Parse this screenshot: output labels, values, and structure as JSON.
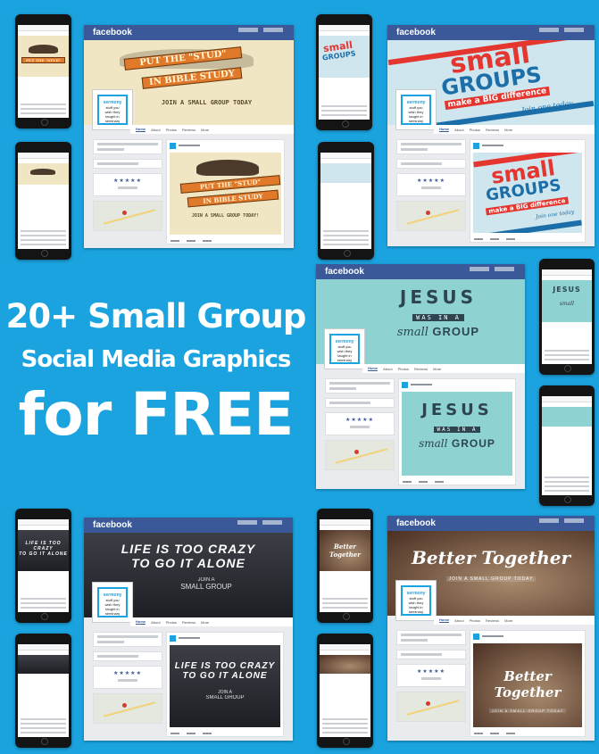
{
  "headline": {
    "line1": "20+ Small Group",
    "line2": "Social Media Graphics",
    "line3": "for FREE"
  },
  "facebook": {
    "brand": "facebook",
    "page_tabs": [
      "Home",
      "About",
      "Photos",
      "Reviews",
      "More"
    ],
    "ratings_stars": "★★★★★"
  },
  "page_logo": {
    "brand": "sermony",
    "lines": [
      "stuff you",
      "wish they",
      "taught in",
      "seminary"
    ]
  },
  "mockups": [
    {
      "id": "stud",
      "line1": "PUT THE \"STUD\"",
      "line2": "IN BIBLE STUDY",
      "tagline": "JOIN A SMALL GROUP TODAY",
      "tagline_post": "JOIN A SMALL GROUP TODAY!"
    },
    {
      "id": "small-groups",
      "word1": "small",
      "word2": "GROUPS",
      "word3": "make a BIG difference",
      "word4": "Join one today"
    },
    {
      "id": "jesus",
      "line1": "JESUS",
      "line2": "WAS IN A",
      "line3": "small",
      "line4": "GROUP"
    },
    {
      "id": "crazy",
      "line1": "LIFE IS TOO CRAZY",
      "line2": "TO GO IT ALONE",
      "line3": "JOIN A",
      "line4": "SMALL GROUP"
    },
    {
      "id": "better",
      "line1": "Better Together",
      "line2": "JOIN A SMALL GROUP TODAY"
    }
  ],
  "colors": {
    "background": "#1ba3df",
    "facebook_blue": "#3b5998"
  }
}
